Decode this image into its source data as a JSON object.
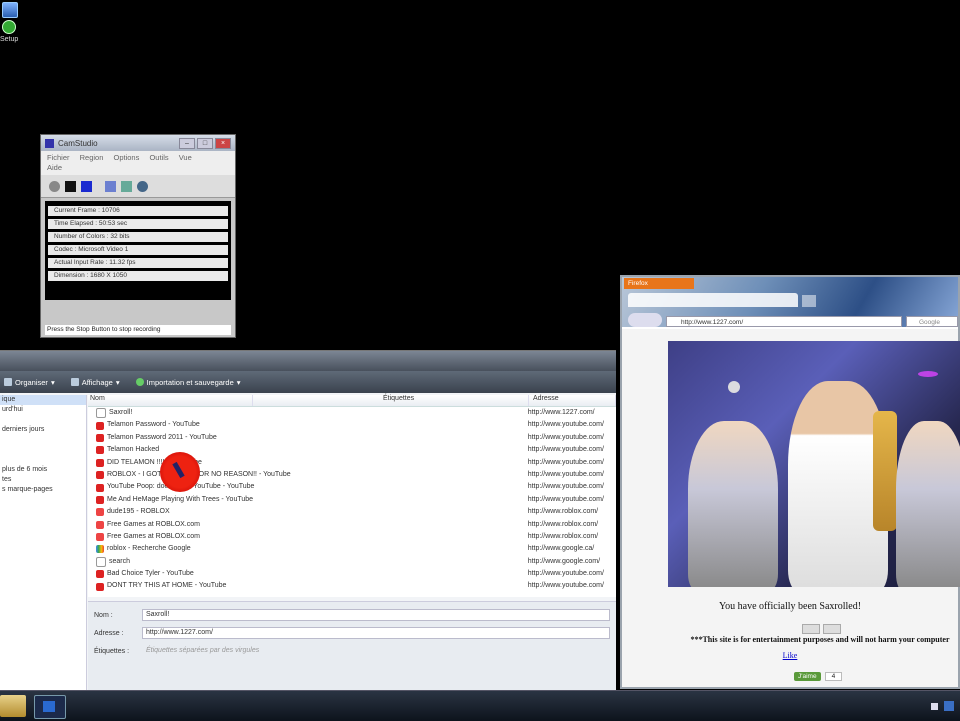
{
  "desktop": {
    "icon_label": "Setup"
  },
  "camstudio": {
    "title": "CamStudio",
    "menu": [
      "Fichier",
      "Region",
      "Options",
      "Outils",
      "Vue",
      "Aide"
    ],
    "stats": [
      "Current Frame : 10706",
      "Time Elapsed : 50:53 sec",
      "Number of Colors : 32 bits",
      "Codec : Microsoft Video 1",
      "Actual Input Rate : 11.32 fps",
      "Dimension : 1680 X 1050"
    ],
    "status": "Press the Stop Button to stop recording",
    "colors": {
      "record": "#888888",
      "stop": "#111111",
      "pause": "#1a2ad0"
    }
  },
  "library": {
    "toolbar": [
      "Organiser",
      "Affichage",
      "Importation et sauvegarde"
    ],
    "sidebar": [
      "ique",
      "urd'hui",
      "",
      "derniers jours",
      "",
      "",
      "",
      "plus de 6 mois",
      "tes",
      "s marque-pages"
    ],
    "columns": [
      "Nom",
      "Étiquettes",
      "Adresse"
    ],
    "rows": [
      {
        "icon": "page",
        "name": "Saxroll!",
        "url": "http://www.1227.com/"
      },
      {
        "icon": "yt",
        "name": "Telamon Password - YouTube",
        "url": "http://www.youtube.com/"
      },
      {
        "icon": "yt",
        "name": "Telamon Password 2011 - YouTube",
        "url": "http://www.youtube.com/"
      },
      {
        "icon": "yt",
        "name": "Telamon Hacked",
        "url": "http://www.youtube.com/"
      },
      {
        "icon": "yt",
        "name": "DID TELAMON !!!!!! - YouTube",
        "url": "http://www.youtube.com/"
      },
      {
        "icon": "yt",
        "name": "ROBLOX - I GOT BANNED FOR NO REASON!! - YouTube",
        "url": "http://www.youtube.com/"
      },
      {
        "icon": "yt",
        "name": "YouTube Poop: doesn't like YouTube - YouTube",
        "url": "http://www.youtube.com/"
      },
      {
        "icon": "yt",
        "name": "Me And HeMage Playing With Trees - YouTube",
        "url": "http://www.youtube.com/"
      },
      {
        "icon": "rb",
        "name": "dude195 - ROBLOX",
        "url": "http://www.roblox.com/"
      },
      {
        "icon": "rb",
        "name": "Free Games at ROBLOX.com",
        "url": "http://www.roblox.com/"
      },
      {
        "icon": "rb",
        "name": "Free Games at ROBLOX.com",
        "url": "http://www.roblox.com/"
      },
      {
        "icon": "google",
        "name": "roblox - Recherche Google",
        "url": "http://www.google.ca/"
      },
      {
        "icon": "page",
        "name": "search",
        "url": "http://www.google.com/"
      },
      {
        "icon": "yt",
        "name": "Bad Choice Tyler - YouTube",
        "url": "http://www.youtube.com/"
      },
      {
        "icon": "yt",
        "name": "DONT TRY THIS AT HOME - YouTube",
        "url": "http://www.youtube.com/"
      }
    ],
    "detail": {
      "name_label": "Nom :",
      "name_value": "Saxroll!",
      "url_label": "Adresse :",
      "url_value": "http://www.1227.com/",
      "tags_label": "Étiquettes :",
      "tags_placeholder": "Étiquettes séparées par des virgules"
    }
  },
  "firefox": {
    "menu_button": "Firefox",
    "url": "http://www.1227.com/",
    "search_placeholder": "Google",
    "message": "You have officially been Saxrolled!",
    "disclaimer": "***This site is for entertainment purposes and will not harm your computer",
    "link": "Like",
    "like_button": "J'aime",
    "like_count": "4"
  }
}
